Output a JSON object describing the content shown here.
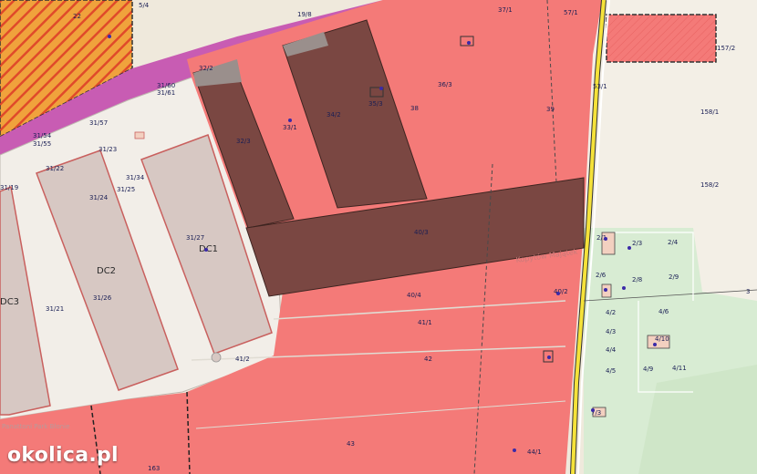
{
  "brand": {
    "watermark": "okolica.pl"
  },
  "colors": {
    "zone_red": "#f47a78",
    "zone_dark": "#7a4742",
    "zone_hatch_orange": "#f0a23c",
    "zone_magenta": "#c85cb3",
    "road_yellow": "#f5e23a",
    "zone_green": "#d8ecd3",
    "zone_beige": "#efe9dc",
    "building_grey": "#d7c8c3"
  },
  "labels": {
    "buildings": {
      "dc1": "DC1",
      "dc2": "DC2",
      "dc3": "DC3"
    },
    "street": "Kopytów Majątek",
    "park": "Panattoni Park Błonie",
    "parcels": {
      "p22": "22",
      "p5_4": "5/4",
      "p19_8": "19/8",
      "p37_1": "37/1",
      "p32_2": "32/2",
      "p31_60": "31/60",
      "p31_61": "31/61",
      "p31_57": "31/57",
      "p31_54": "31/54",
      "p31_55": "31/55",
      "p31_23": "31/23",
      "p31_22": "31/22",
      "p31_19": "31/19",
      "p31_34": "31/34",
      "p31_24": "31/24",
      "p31_25": "31/25",
      "p31_27": "31/27",
      "p31_26": "31/26",
      "p31_21": "31/21",
      "p32_3": "32/3",
      "p33_1": "33/1",
      "p34_2": "34/2",
      "p35_3": "35/3",
      "p36_3": "36/3",
      "p38": "38",
      "p39": "39",
      "p40_3": "40/3",
      "p40_4": "40/4",
      "p40_2": "40/2",
      "p41_1": "41/1",
      "p41_2": "41/2",
      "p42": "42",
      "p43": "43",
      "p163": "163",
      "p44_1": "44/1",
      "p158_1": "158/1",
      "p158_2": "158/2",
      "p157_2": "157/2",
      "p2_1": "2/1",
      "p2_3": "2/3",
      "p2_4": "2/4",
      "p2_6": "2/6",
      "p2_8": "2/8",
      "p2_9": "2/9",
      "p3": "3",
      "p4_2": "4/2",
      "p4_6": "4/6",
      "p4_3": "4/3",
      "p4_10": "4/10",
      "p4_4": "4/4",
      "p4_5": "4/5",
      "p4_9": "4/9",
      "p4_11": "4/11",
      "p7_3": "7/3",
      "p53_1": "53/1",
      "p57_1": "57/1"
    }
  }
}
